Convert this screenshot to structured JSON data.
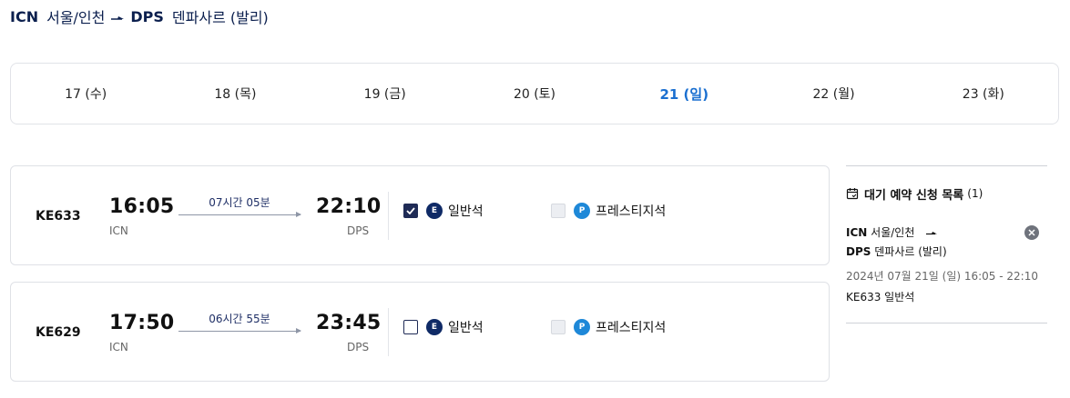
{
  "route": {
    "origin_code": "ICN",
    "origin_city": "서울/인천",
    "dest_code": "DPS",
    "dest_city": "덴파사르 (발리)"
  },
  "dates": [
    {
      "label": "17 (수)",
      "active": false
    },
    {
      "label": "18 (목)",
      "active": false
    },
    {
      "label": "19 (금)",
      "active": false
    },
    {
      "label": "20 (토)",
      "active": false
    },
    {
      "label": "21 (일)",
      "active": true
    },
    {
      "label": "22 (월)",
      "active": false
    },
    {
      "label": "23 (화)",
      "active": false
    }
  ],
  "flights": [
    {
      "flight_no": "KE633",
      "dep_time": "16:05",
      "dep_code": "ICN",
      "duration": "07시간 05분",
      "arr_time": "22:10",
      "arr_code": "DPS",
      "economy": {
        "badge": "E",
        "label": "일반석",
        "checked": true
      },
      "prestige": {
        "badge": "P",
        "label": "프레스티지석",
        "disabled": true
      }
    },
    {
      "flight_no": "KE629",
      "dep_time": "17:50",
      "dep_code": "ICN",
      "duration": "06시간 55분",
      "arr_time": "23:45",
      "arr_code": "DPS",
      "economy": {
        "badge": "E",
        "label": "일반석",
        "checked": false
      },
      "prestige": {
        "badge": "P",
        "label": "프레스티지석",
        "disabled": true
      }
    }
  ],
  "waitlist": {
    "title": "대기 예약 신청 목록",
    "count": "(1)",
    "origin_code": "ICN",
    "origin_city": "서울/인천",
    "dest_code": "DPS",
    "dest_city": "덴파사르 (발리)",
    "datetime": "2024년 07월 21일 (일) 16:05 - 22:10",
    "flight": "KE633 일반석"
  },
  "colors": {
    "navy": "#0b1f4e",
    "accent_blue": "#1a6fd0",
    "economy_badge": "#0f2a66",
    "prestige_badge": "#1e88d8"
  },
  "icons": {
    "route_arrow": "plane-arrow-icon",
    "calendar": "calendar-icon",
    "close": "close-icon",
    "check": "check-icon"
  }
}
